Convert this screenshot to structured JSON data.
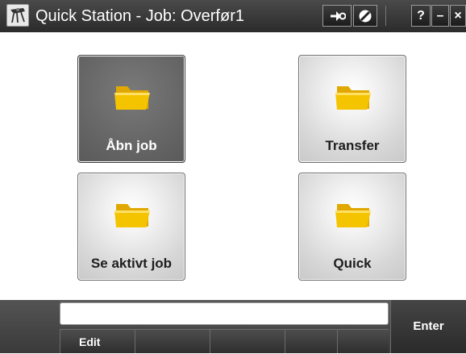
{
  "titlebar": {
    "app_icon": "surveyor-icon",
    "title": "Quick Station - Job: Overfør1",
    "buttons": {
      "back_icon": "arrow-right-icon",
      "satellite_icon": "no-signal-icon",
      "help_label": "?",
      "minimize_label": "–",
      "close_label": "×"
    }
  },
  "tiles": [
    {
      "label": "Åbn job",
      "icon": "folder-icon",
      "selected": true
    },
    {
      "label": "Transfer",
      "icon": "folder-icon",
      "selected": false
    },
    {
      "label": "Se aktivt job",
      "icon": "folder-icon",
      "selected": false
    },
    {
      "label": "Quick",
      "icon": "folder-icon",
      "selected": false
    }
  ],
  "bottombar": {
    "input_value": "",
    "softkeys": [
      "Edit",
      "",
      "",
      "",
      ""
    ],
    "enter_label": "Enter"
  },
  "colors": {
    "titlebar": "#2b2b2b",
    "folder": "#f5c400",
    "selected_tile": "#666666"
  }
}
